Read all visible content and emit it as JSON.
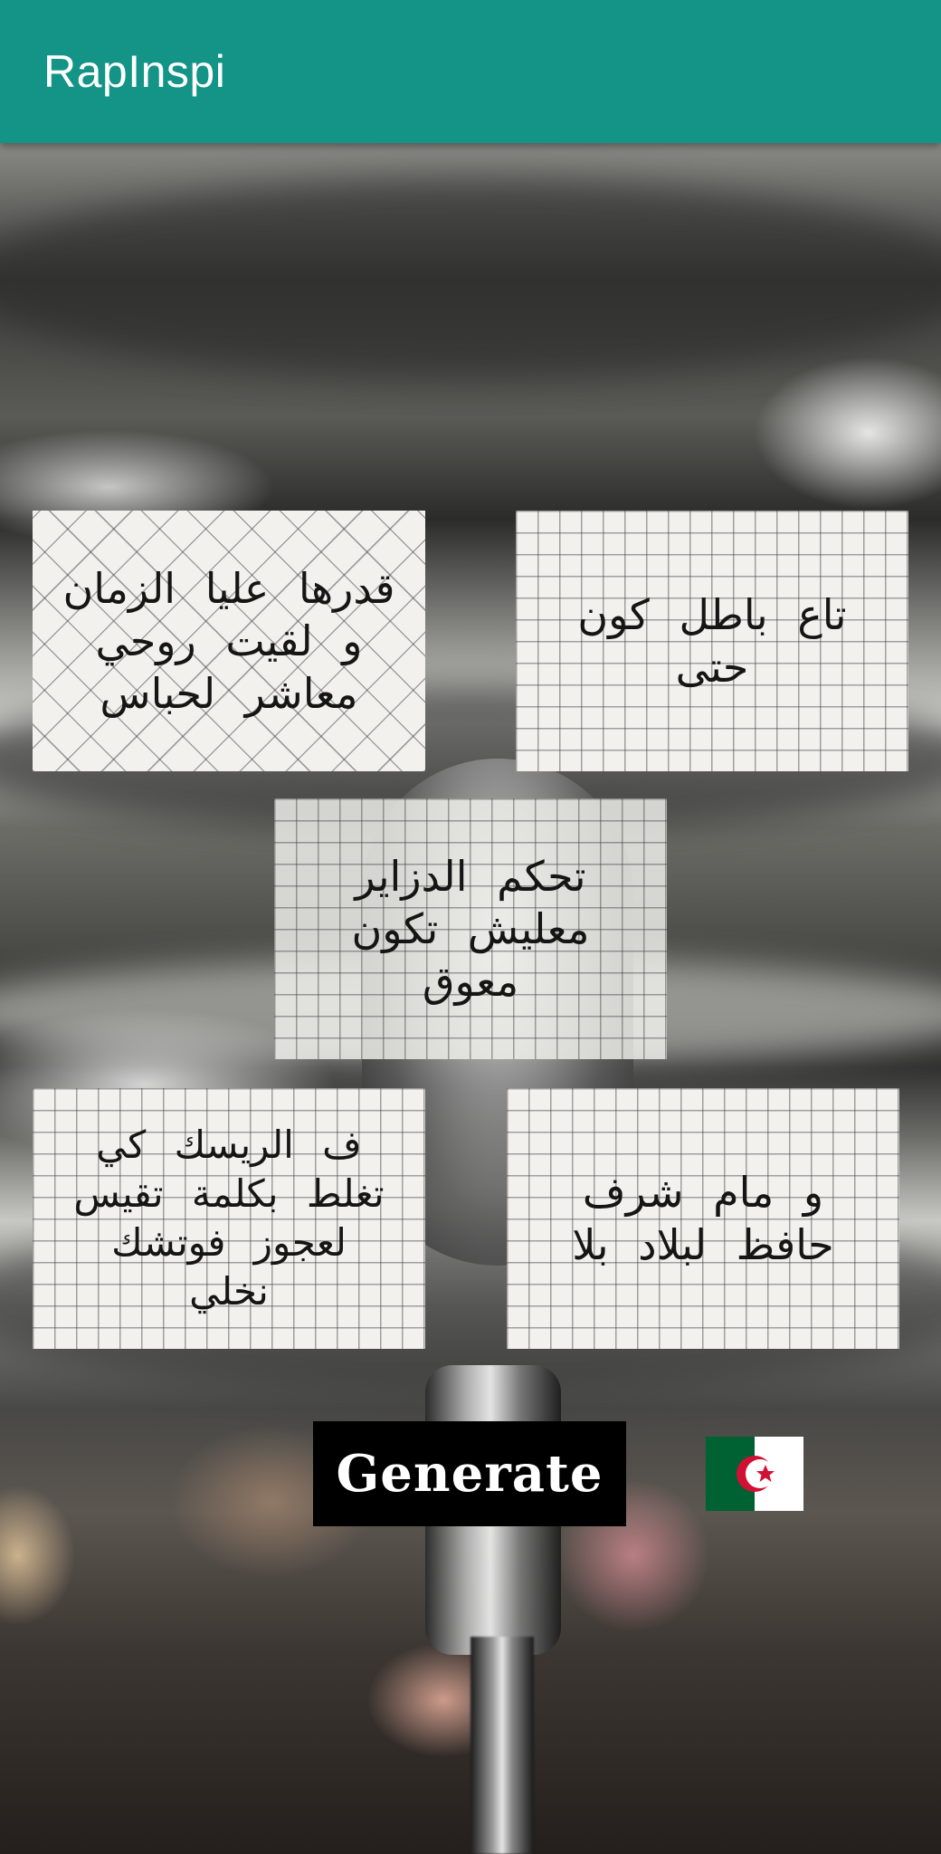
{
  "app_bar": {
    "title": "RapInspi",
    "color": "#139487"
  },
  "lyrics": [
    {
      "id": "card-1",
      "text": "قدرها عليا الزمان\nو لقيت روحي\nمعاشر لحباس"
    },
    {
      "id": "card-2",
      "text": "تاع باطل كون\nحتى"
    },
    {
      "id": "card-3",
      "text": "تحكم الدزاير\nمعليش تكون\nمعوق"
    },
    {
      "id": "card-4",
      "text": "ف الريسك كي\nتغلط بكلمة تقيس\nلعجوز فوتشك\nنخلي"
    },
    {
      "id": "card-5",
      "text": "و مام شرف\nحافظ لبلاد بلا"
    }
  ],
  "generate_button": {
    "label": "Generate"
  },
  "flag": {
    "icon": "algeria-flag-icon",
    "colors": {
      "green": "#006233",
      "white": "#ffffff",
      "red": "#d21034"
    }
  }
}
